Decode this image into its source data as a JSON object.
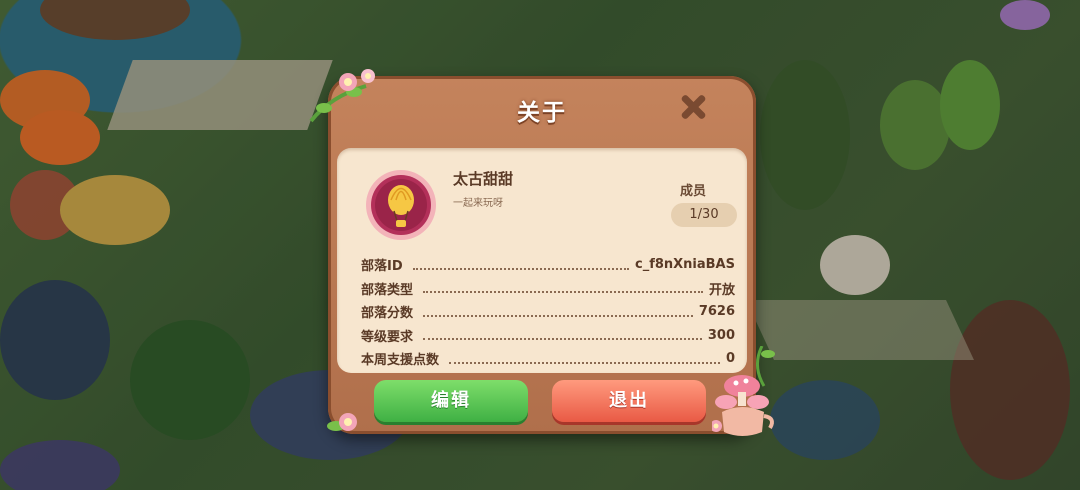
{
  "dialog": {
    "title": "关于",
    "clan": {
      "name": "太古甜甜",
      "motto": "一起来玩呀",
      "badge_icon": "hot-air-balloon-icon"
    },
    "members": {
      "label": "成员",
      "count": "1/30"
    },
    "details": [
      {
        "label": "部落ID",
        "value": "c_f8nXniaBAS"
      },
      {
        "label": "部落类型",
        "value": "开放"
      },
      {
        "label": "部落分数",
        "value": "7626"
      },
      {
        "label": "等级要求",
        "value": "300"
      },
      {
        "label": "本周支援点数",
        "value": "0"
      }
    ],
    "buttons": {
      "edit": "编辑",
      "exit": "退出"
    },
    "colors": {
      "frame": "#b8754f",
      "panel": "#f7e6cf",
      "edit_button": "#4fbf4a",
      "exit_button": "#ee6a52",
      "badge": "#b3305a"
    }
  }
}
